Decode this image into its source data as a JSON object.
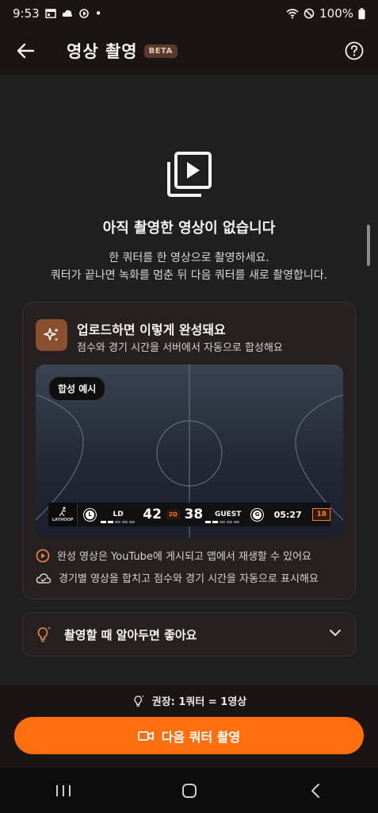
{
  "status_bar": {
    "time": "9:53",
    "dot": "•",
    "battery": "100%"
  },
  "header": {
    "title": "영상 촬영",
    "badge": "BETA"
  },
  "empty_state": {
    "title": "아직 촬영한 영상이 없습니다",
    "desc_line1": "한 쿼터를 한 영상으로 촬영하세요.",
    "desc_line2": "쿼터가 끝나면 녹화를 멈춘 뒤 다음 쿼터를 새로 촬영합니다."
  },
  "upload_card": {
    "title": "업로드하면 이렇게 완성돼요",
    "subtitle": "점수와 경기 시간을 서버에서 자동으로 합성해요",
    "preview_badge": "합성 예시",
    "scoreboard": {
      "logo_text": "LAYHOOP",
      "home_initial": "L",
      "home_name": "LD",
      "home_score": "42",
      "quarter": "2Q",
      "away_score": "38",
      "away_name": "GUEST",
      "away_initial": "G",
      "clock": "05:27",
      "shot_clock": "18"
    },
    "info1": "완성 영상은 YouTube에 게시되고 앱에서 재생할 수 있어요",
    "info2": "경기별 영상을 합치고 점수와 경기 시간을 자동으로 표시해요"
  },
  "tips": {
    "label": "촬영할 때 알아두면 좋아요"
  },
  "bottom": {
    "recommend": "권장: 1쿼터 = 1영상",
    "cta_label": "다음 쿼터 촬영"
  },
  "colors": {
    "accent": "#ff6f0f",
    "background": "#1f1f1f",
    "card": "#262120"
  }
}
